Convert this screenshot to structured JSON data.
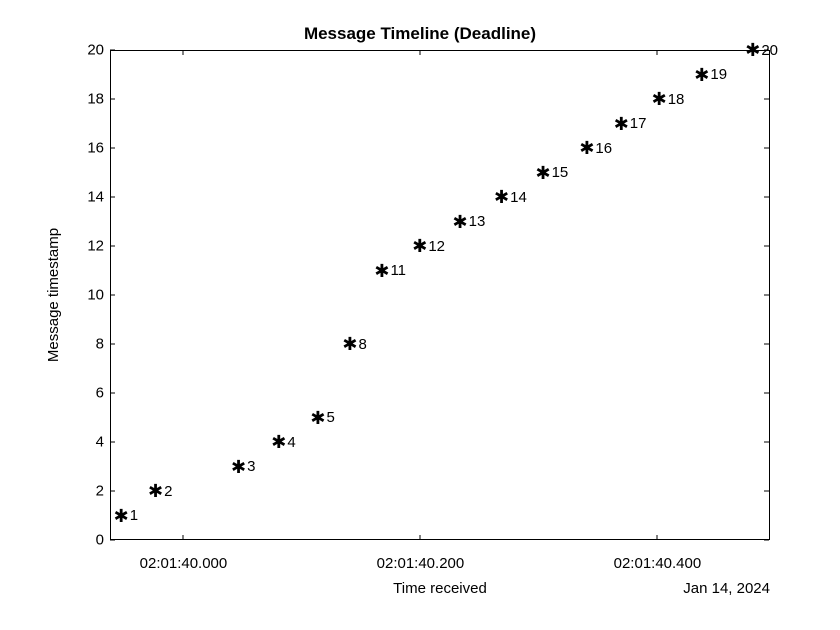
{
  "chart_data": {
    "type": "scatter",
    "title": "Message Timeline (Deadline)",
    "xlabel": "Time received",
    "ylabel": "Message timestamp",
    "date_subtitle": "Jan 14, 2024",
    "ylim": [
      0,
      20
    ],
    "yticks": [
      0,
      2,
      4,
      6,
      8,
      10,
      12,
      14,
      16,
      18,
      20
    ],
    "xlim_ms": [
      -62,
      495
    ],
    "xticks": [
      {
        "ms": 0,
        "label": "02:01:40.000"
      },
      {
        "ms": 200,
        "label": "02:01:40.200"
      },
      {
        "ms": 400,
        "label": "02:01:40.400"
      }
    ],
    "points": [
      {
        "x_ms": -53,
        "y": 1,
        "label": "1"
      },
      {
        "x_ms": -24,
        "y": 2,
        "label": "2"
      },
      {
        "x_ms": 46,
        "y": 3,
        "label": "3"
      },
      {
        "x_ms": 80,
        "y": 4,
        "label": "4"
      },
      {
        "x_ms": 113,
        "y": 5,
        "label": "5"
      },
      {
        "x_ms": 140,
        "y": 8,
        "label": "8"
      },
      {
        "x_ms": 167,
        "y": 11,
        "label": "11"
      },
      {
        "x_ms": 199,
        "y": 12,
        "label": "12"
      },
      {
        "x_ms": 233,
        "y": 13,
        "label": "13"
      },
      {
        "x_ms": 268,
        "y": 14,
        "label": "14"
      },
      {
        "x_ms": 303,
        "y": 15,
        "label": "15"
      },
      {
        "x_ms": 340,
        "y": 16,
        "label": "16"
      },
      {
        "x_ms": 369,
        "y": 17,
        "label": "17"
      },
      {
        "x_ms": 401,
        "y": 18,
        "label": "18"
      },
      {
        "x_ms": 437,
        "y": 19,
        "label": "19"
      },
      {
        "x_ms": 480,
        "y": 20,
        "label": "20"
      }
    ]
  }
}
